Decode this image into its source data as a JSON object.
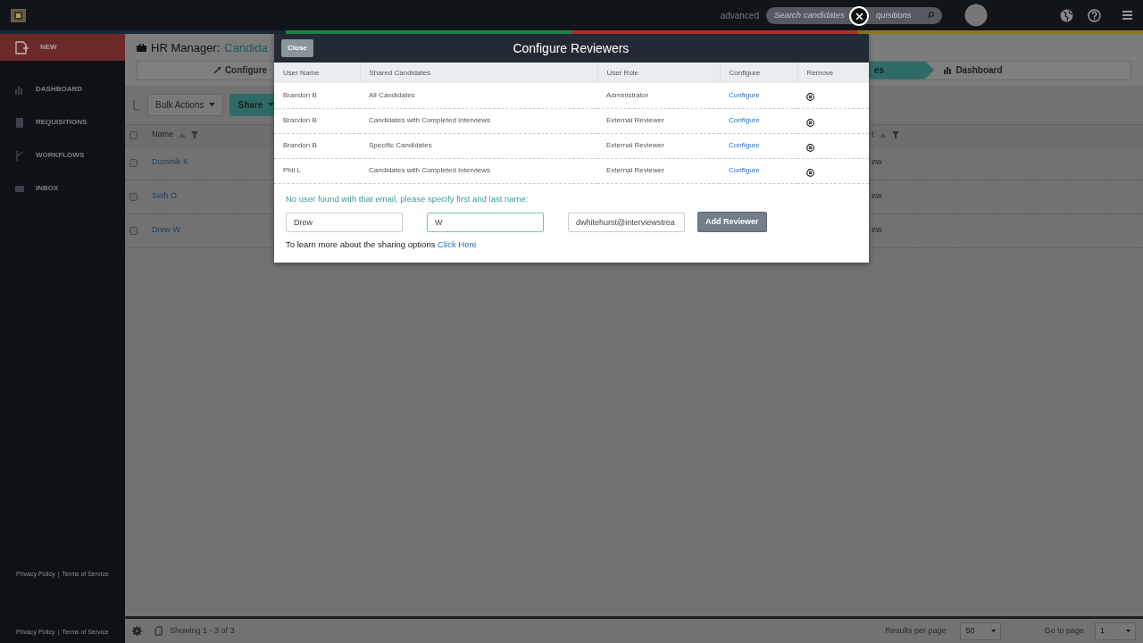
{
  "topbar": {
    "advanced": "advanced",
    "search": {
      "placeholder": "Search candidates",
      "text_after_close": "quisitions"
    },
    "strip": [
      {
        "color": "#1b2a3a"
      },
      {
        "color": "#1e8a4a"
      },
      {
        "color": "#b8312d"
      },
      {
        "color": "#8a7a1e"
      }
    ]
  },
  "sidebar": {
    "items": [
      {
        "label": "NEW",
        "selected": true
      },
      {
        "label": "DASHBOARD",
        "selected": false
      },
      {
        "label": "REQUISITIONS",
        "selected": false
      },
      {
        "label": "WORKFLOWS",
        "selected": false
      },
      {
        "label": "INBOX",
        "selected": false
      }
    ],
    "footers": [
      {
        "links": [
          "Privacy Policy",
          "Terms of Service"
        ],
        "separator": "|"
      },
      {
        "links": [
          "Privacy Policy",
          "Terms of Service"
        ],
        "separator": "|"
      }
    ]
  },
  "page": {
    "title": "HR Manager:",
    "title_highlight": "Candida",
    "steps": [
      {
        "label": "Configure",
        "selected": false
      },
      {
        "label": "es",
        "selected": true
      },
      {
        "label": "Dashboard",
        "selected": false
      }
    ],
    "toolbar": {
      "bulk": "Bulk Actions",
      "share": "Share"
    },
    "table": {
      "columns": [
        "Name",
        "t"
      ],
      "select_all_checked": false,
      "rows": [
        {
          "name": "Dominik K",
          "column_2": "ew",
          "checked": false
        },
        {
          "name": "Seth O",
          "column_2": "ew",
          "checked": false
        },
        {
          "name": "Drew W",
          "column_2": "ew",
          "checked": false
        }
      ]
    }
  },
  "footer": {
    "showing": "Showing 1 - 3 of 3",
    "results_label": "Results per page",
    "results_value": "50",
    "goto_label": "Go to page",
    "goto_value": "1"
  },
  "modal": {
    "close": "Close",
    "title": "Configure Reviewers",
    "columns": [
      "User Name",
      "Shared Candidates",
      "User Role",
      "Configure",
      "Remove"
    ],
    "rows": [
      {
        "user": "Brandon B",
        "shared": "All Candidates",
        "role": "Administrator",
        "configure": "Configure"
      },
      {
        "user": "Brandon B",
        "shared": "Candidates with Completed Interviews",
        "role": "External Reviewer",
        "configure": "Configure"
      },
      {
        "user": "Brandon B",
        "shared": "Specific Candidates",
        "role": "External Reviewer",
        "configure": "Configure"
      },
      {
        "user": "Phil L",
        "shared": "Candidates with Completed Interviews",
        "role": "External Reviewer",
        "configure": "Configure"
      }
    ],
    "notice": "No user found with that email, please specify first and last name:",
    "fields": [
      {
        "value": "Drew",
        "focused": false
      },
      {
        "value": "W",
        "focused": true
      },
      {
        "value": "dwhitehurst@interviewstrea",
        "focused": false
      }
    ],
    "add_button": "Add Reviewer",
    "learn_more": "To learn more about the sharing options",
    "learn_link": "Click Here"
  }
}
